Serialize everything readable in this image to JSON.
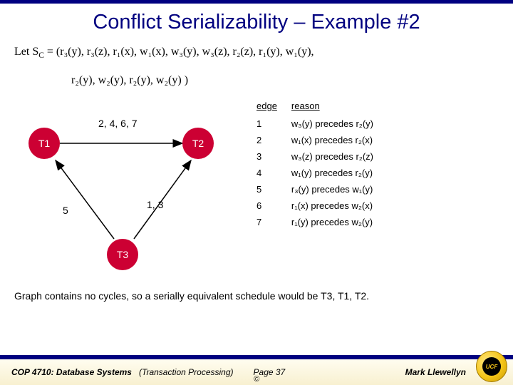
{
  "title": "Conflict Serializability – Example #2",
  "schedule_prefix": "Let S",
  "schedule_sub": "C",
  "schedule_rest": " = (r₃(y), r₃(z), r₁(x), w₁(x), w₃(y), w₃(z), r₂(z), r₁(y), w₁(y),",
  "schedule_line2": "r₂(y), w₂(y), r₂(y), w₂(y) )",
  "nodes": {
    "t1": "T1",
    "t2": "T2",
    "t3": "T3"
  },
  "edge_labels": {
    "top": "2, 4, 6, 7",
    "mid": "1, 3",
    "left": "5"
  },
  "table": {
    "head_edge": "edge",
    "head_reason": "reason",
    "rows": [
      {
        "n": "1",
        "r": "w₃(y) precedes r₂(y)"
      },
      {
        "n": "2",
        "r": "w₁(x) precedes r₂(x)"
      },
      {
        "n": "3",
        "r": "w₃(z) precedes r₂(z)"
      },
      {
        "n": "4",
        "r": "w₁(y) precedes r₂(y)"
      },
      {
        "n": "5",
        "r": "r₃(y) precedes w₁(y)"
      },
      {
        "n": "6",
        "r": "r₁(x) precedes w₂(x)"
      },
      {
        "n": "7",
        "r": "r₁(y) precedes w₂(y)"
      }
    ]
  },
  "conclusion": "Graph contains no cycles, so a serially equivalent schedule would be T3, T1, T2.",
  "footer": {
    "course_label": "COP 4710: Database Systems",
    "section": "(Transaction Processing)",
    "page": "Page 37",
    "author": "Mark Llewellyn",
    "copyright": "©",
    "seal": "UCF"
  }
}
